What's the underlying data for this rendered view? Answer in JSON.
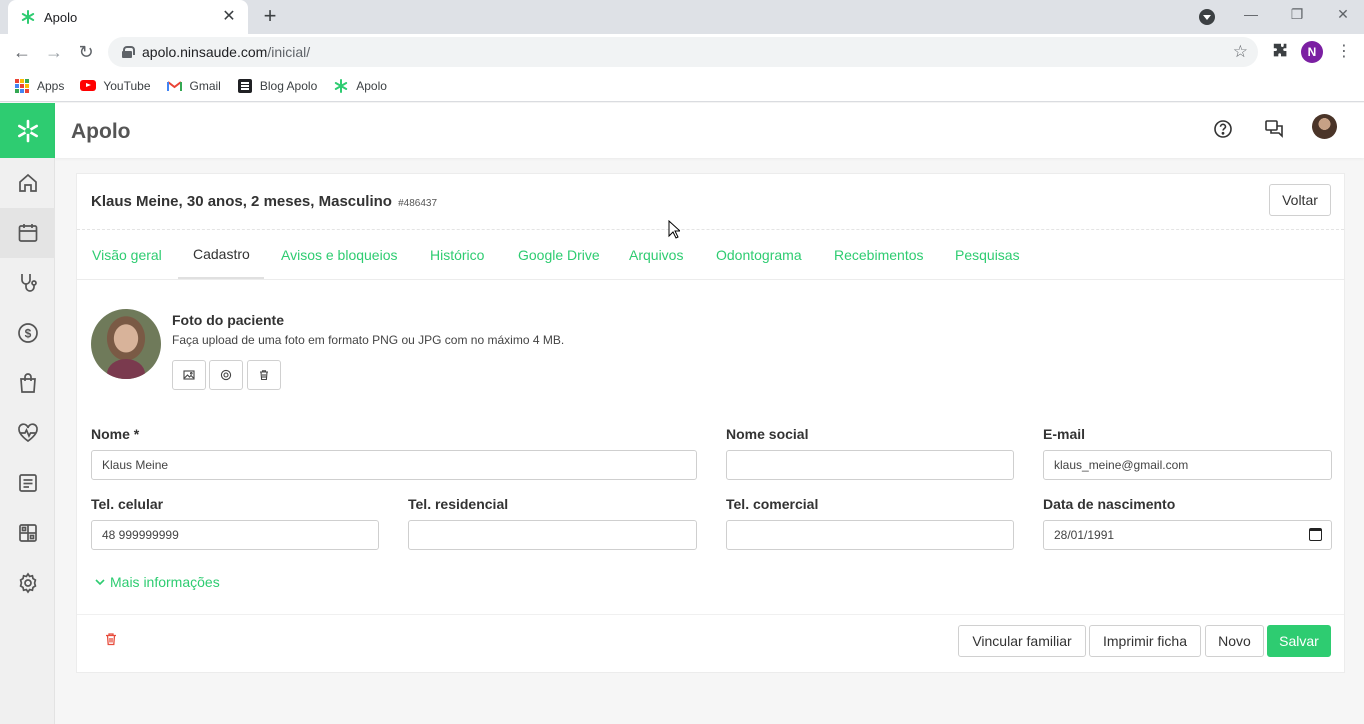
{
  "browser": {
    "tab_title": "Apolo",
    "close_tab": "✕",
    "new_tab": "+",
    "url_host": "apolo.ninsaude.com",
    "url_path": "/inicial/",
    "profile_initial": "N",
    "bookmarks": [
      {
        "label": "Apps",
        "icon": "apps-grid-icon"
      },
      {
        "label": "YouTube",
        "icon": "youtube-icon"
      },
      {
        "label": "Gmail",
        "icon": "gmail-icon"
      },
      {
        "label": "Blog Apolo",
        "icon": "blog-icon"
      },
      {
        "label": "Apolo",
        "icon": "apolo-icon"
      }
    ]
  },
  "app": {
    "title": "Apolo",
    "accent_color": "#2ecc71",
    "sidebar_icons": [
      "home-icon",
      "calendar-icon",
      "stethoscope-icon",
      "dollar-icon",
      "bag-icon",
      "heartbeat-icon",
      "report-icon",
      "dashboard-icon",
      "settings-icon"
    ],
    "header_icons": [
      "help-icon",
      "chat-icon",
      "user-avatar"
    ]
  },
  "patient": {
    "title": "Klaus Meine, 30 anos, 2 meses, Masculino",
    "id": "#486437",
    "back_button": "Voltar",
    "tabs": [
      {
        "label": "Visão geral",
        "active": false
      },
      {
        "label": "Cadastro",
        "active": true
      },
      {
        "label": "Avisos e bloqueios",
        "active": false
      },
      {
        "label": "Histórico",
        "active": false
      },
      {
        "label": "Google Drive",
        "active": false
      },
      {
        "label": "Arquivos",
        "active": false
      },
      {
        "label": "Odontograma",
        "active": false
      },
      {
        "label": "Recebimentos",
        "active": false
      },
      {
        "label": "Pesquisas",
        "active": false
      }
    ],
    "photo": {
      "title": "Foto do paciente",
      "description": "Faça upload de uma foto em formato PNG ou JPG com no máximo 4 MB."
    },
    "fields": {
      "nome": {
        "label": "Nome *",
        "value": "Klaus Meine"
      },
      "nome_social": {
        "label": "Nome social",
        "value": ""
      },
      "email": {
        "label": "E-mail",
        "value": "klaus_meine@gmail.com"
      },
      "tel_celular": {
        "label": "Tel. celular",
        "value": "48 999999999"
      },
      "tel_residencial": {
        "label": "Tel. residencial",
        "value": ""
      },
      "tel_comercial": {
        "label": "Tel. comercial",
        "value": ""
      },
      "nascimento": {
        "label": "Data de nascimento",
        "value": "28/01/1991"
      }
    },
    "more_info": "Mais informações",
    "actions": {
      "vincular": "Vincular familiar",
      "imprimir": "Imprimir ficha",
      "novo": "Novo",
      "salvar": "Salvar"
    }
  }
}
